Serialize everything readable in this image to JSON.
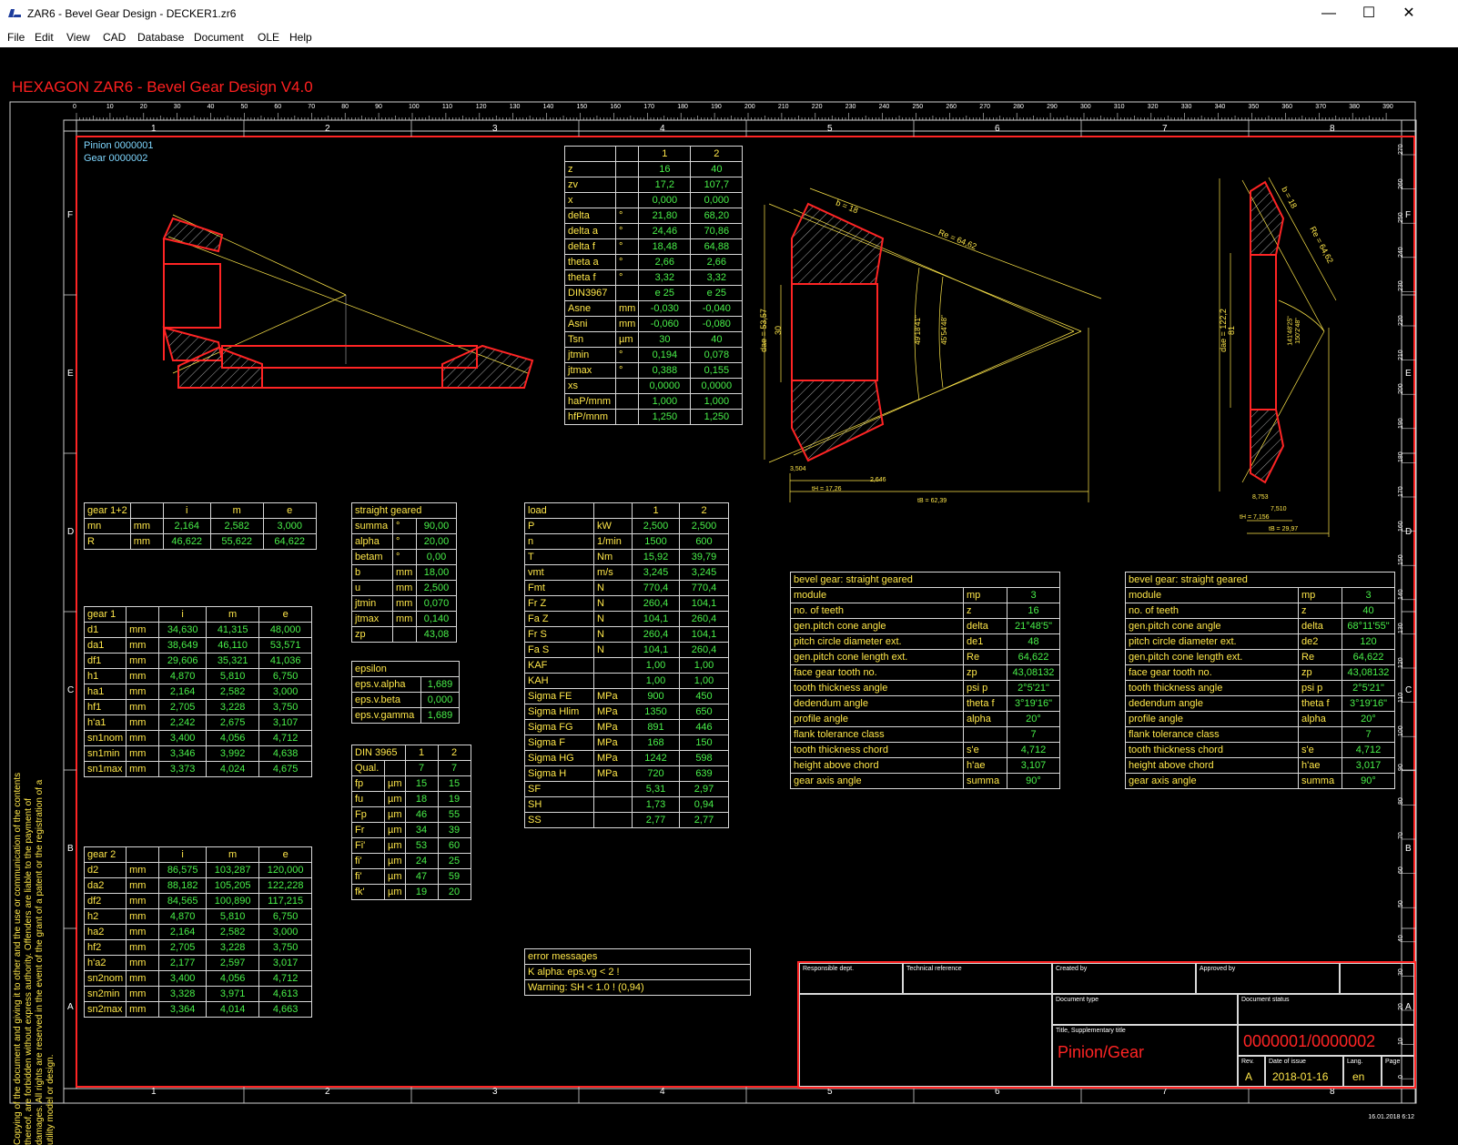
{
  "window": {
    "title": "ZAR6 - Bevel Gear Design  -  DECKER1.zr6",
    "minimize": "—",
    "maximize": "☐",
    "close": "✕"
  },
  "menu": [
    "File",
    "Edit",
    "View",
    "CAD",
    "Database",
    "Document",
    "OLE",
    "Help"
  ],
  "app_title": "HEXAGON   ZAR6 - Bevel Gear Design  V4.0",
  "ruler": {
    "top_ticks": [
      "0",
      "10",
      "20",
      "30",
      "40",
      "50",
      "60",
      "70",
      "80",
      "90",
      "100",
      "110",
      "120",
      "130",
      "140",
      "150",
      "160",
      "170",
      "180",
      "190",
      "200",
      "210",
      "220",
      "230",
      "240",
      "250",
      "260",
      "270",
      "280",
      "290",
      "300",
      "310",
      "320",
      "330",
      "340",
      "350",
      "360",
      "370",
      "380",
      "390"
    ],
    "right_ticks": [
      "270",
      "260",
      "250",
      "240",
      "230",
      "220",
      "210",
      "200",
      "190",
      "180",
      "170",
      "160",
      "150",
      "140",
      "130",
      "120",
      "110",
      "100",
      "90",
      "80",
      "70",
      "60",
      "50",
      "40",
      "30",
      "20",
      "10",
      "0"
    ],
    "columns": [
      "1",
      "2",
      "3",
      "4",
      "5",
      "6",
      "7",
      "8"
    ],
    "rows": [
      "F",
      "E",
      "D",
      "C",
      "B",
      "A"
    ]
  },
  "parts": {
    "pinion": "Pinion  0000001",
    "gear": "Gear  0000002"
  },
  "drawing_labels": {
    "b1": "b = 18",
    "re1": "Re = 64,62",
    "dae1": "dae = 53,57",
    "d1s": "30",
    "ang1a": "49'18'41\"",
    "ang1b": "45'54'48\"",
    "tH1": "tH = 17,26",
    "tB1": "tB = 62,39",
    "v1": "3,504",
    "v2": "2,646",
    "b2": "b = 18",
    "re2": "Re = 64,62",
    "dae2": "dae = 122,2",
    "d2s": "81",
    "ang2a": "141'48'25\"",
    "ang2b": "150'2'48\"",
    "tH2": "tH = 7,156",
    "tB2": "tB = 29,97",
    "v3": "8,753",
    "v4": "7,510"
  },
  "param_table": {
    "header": [
      "",
      "",
      "1",
      "2"
    ],
    "rows": [
      [
        "z",
        "",
        "16",
        "40"
      ],
      [
        "zv",
        "",
        "17,2",
        "107,7"
      ],
      [
        "x",
        "",
        "0,000",
        "0,000"
      ],
      [
        "delta",
        "°",
        "21,80",
        "68,20"
      ],
      [
        "delta a",
        "°",
        "24,46",
        "70,86"
      ],
      [
        "delta f",
        "°",
        "18,48",
        "64,88"
      ],
      [
        "theta a",
        "°",
        "2,66",
        "2,66"
      ],
      [
        "theta f",
        "°",
        "3,32",
        "3,32"
      ],
      [
        "DIN3967",
        "",
        "e 25",
        "e 25"
      ],
      [
        "Asne",
        "mm",
        "-0,030",
        "-0,040"
      ],
      [
        "Asni",
        "mm",
        "-0,060",
        "-0,080"
      ],
      [
        "Tsn",
        "µm",
        "30",
        "40"
      ],
      [
        "jtmin",
        "°",
        "0,194",
        "0,078"
      ],
      [
        "jtmax",
        "°",
        "0,388",
        "0,155"
      ],
      [
        "xs",
        "",
        "0,0000",
        "0,0000"
      ],
      [
        "haP/mnm",
        "",
        "1,000",
        "1,000"
      ],
      [
        "hfP/mnm",
        "",
        "1,250",
        "1,250"
      ]
    ]
  },
  "gear12": {
    "header": [
      "gear 1+2",
      "",
      "i",
      "m",
      "e"
    ],
    "rows": [
      [
        "mn",
        "mm",
        "2,164",
        "2,582",
        "3,000"
      ],
      [
        "R",
        "mm",
        "46,622",
        "55,622",
        "64,622"
      ]
    ]
  },
  "gear1": {
    "header": [
      "gear 1",
      "",
      "i",
      "m",
      "e"
    ],
    "rows": [
      [
        "d1",
        "mm",
        "34,630",
        "41,315",
        "48,000"
      ],
      [
        "da1",
        "mm",
        "38,649",
        "46,110",
        "53,571"
      ],
      [
        "df1",
        "mm",
        "29,606",
        "35,321",
        "41,036"
      ],
      [
        "h1",
        "mm",
        "4,870",
        "5,810",
        "6,750"
      ],
      [
        "ha1",
        "mm",
        "2,164",
        "2,582",
        "3,000"
      ],
      [
        "hf1",
        "mm",
        "2,705",
        "3,228",
        "3,750"
      ],
      [
        "h'a1",
        "mm",
        "2,242",
        "2,675",
        "3,107"
      ],
      [
        "sn1nom",
        "mm",
        "3,400",
        "4,056",
        "4,712"
      ],
      [
        "sn1min",
        "mm",
        "3,346",
        "3,992",
        "4,638"
      ],
      [
        "sn1max",
        "mm",
        "3,373",
        "4,024",
        "4,675"
      ]
    ]
  },
  "gear2": {
    "header": [
      "gear 2",
      "",
      "i",
      "m",
      "e"
    ],
    "rows": [
      [
        "d2",
        "mm",
        "86,575",
        "103,287",
        "120,000"
      ],
      [
        "da2",
        "mm",
        "88,182",
        "105,205",
        "122,228"
      ],
      [
        "df2",
        "mm",
        "84,565",
        "100,890",
        "117,215"
      ],
      [
        "h2",
        "mm",
        "4,870",
        "5,810",
        "6,750"
      ],
      [
        "ha2",
        "mm",
        "2,164",
        "2,582",
        "3,000"
      ],
      [
        "hf2",
        "mm",
        "2,705",
        "3,228",
        "3,750"
      ],
      [
        "h'a2",
        "mm",
        "2,177",
        "2,597",
        "3,017"
      ],
      [
        "sn2nom",
        "mm",
        "3,400",
        "4,056",
        "4,712"
      ],
      [
        "sn2min",
        "mm",
        "3,328",
        "3,971",
        "4,613"
      ],
      [
        "sn2max",
        "mm",
        "3,364",
        "4,014",
        "4,663"
      ]
    ]
  },
  "straight": {
    "header": [
      "straight geared"
    ],
    "rows": [
      [
        "summa",
        "°",
        "90,00"
      ],
      [
        "alpha",
        "°",
        "20,00"
      ],
      [
        "betam",
        "°",
        "0,00"
      ],
      [
        "b",
        "mm",
        "18,00"
      ],
      [
        "u",
        "mm",
        "2,500"
      ],
      [
        "jtmin",
        "mm",
        "0,070"
      ],
      [
        "jtmax",
        "mm",
        "0,140"
      ],
      [
        "zp",
        "",
        "43,08"
      ]
    ]
  },
  "epsilon": {
    "header": [
      "epsilon"
    ],
    "rows": [
      [
        "eps.v.alpha",
        "1,689"
      ],
      [
        "eps.v.beta",
        "0,000"
      ],
      [
        "eps.v.gamma",
        "1,689"
      ]
    ]
  },
  "din3965": {
    "header": [
      "DIN 3965",
      "1",
      "2"
    ],
    "rows": [
      [
        "Qual.",
        "",
        "7",
        "7"
      ],
      [
        "fp",
        "µm",
        "15",
        "15"
      ],
      [
        "fu",
        "µm",
        "18",
        "19"
      ],
      [
        "Fp",
        "µm",
        "46",
        "55"
      ],
      [
        "Fr",
        "µm",
        "34",
        "39"
      ],
      [
        "Fi'",
        "µm",
        "53",
        "60"
      ],
      [
        "fi'",
        "µm",
        "24",
        "25"
      ],
      [
        "fi'",
        "µm",
        "47",
        "59"
      ],
      [
        "fk'",
        "µm",
        "19",
        "20"
      ]
    ]
  },
  "load": {
    "header": [
      "load",
      "",
      "1",
      "2"
    ],
    "rows": [
      [
        "P",
        "kW",
        "2,500",
        "2,500"
      ],
      [
        "n",
        "1/min",
        "1500",
        "600"
      ],
      [
        "T",
        "Nm",
        "15,92",
        "39,79"
      ],
      [
        "vmt",
        "m/s",
        "3,245",
        "3,245"
      ],
      [
        "Fmt",
        "N",
        "770,4",
        "770,4"
      ],
      [
        "Fr Z",
        "N",
        "260,4",
        "104,1"
      ],
      [
        "Fa Z",
        "N",
        "104,1",
        "260,4"
      ],
      [
        "Fr S",
        "N",
        "260,4",
        "104,1"
      ],
      [
        "Fa S",
        "N",
        "104,1",
        "260,4"
      ],
      [
        "KAF",
        "",
        "1,00",
        "1,00"
      ],
      [
        "KAH",
        "",
        "1,00",
        "1,00"
      ],
      [
        "Sigma FE",
        "MPa",
        "900",
        "450"
      ],
      [
        "Sigma Hlim",
        "MPa",
        "1350",
        "650"
      ],
      [
        "Sigma FG",
        "MPa",
        "891",
        "446"
      ],
      [
        "Sigma F",
        "MPa",
        "168",
        "150"
      ],
      [
        "Sigma HG",
        "MPa",
        "1242",
        "598"
      ],
      [
        "Sigma H",
        "MPa",
        "720",
        "639"
      ],
      [
        "SF",
        "",
        "5,31",
        "2,97"
      ],
      [
        "SH",
        "",
        "1,73",
        "0,94"
      ],
      [
        "SS",
        "",
        "2,77",
        "2,77"
      ]
    ]
  },
  "errors": {
    "header": "error messages",
    "rows": [
      "K alpha: eps.vg < 2 !",
      "Warning: SH < 1.0 ! (0,94)"
    ]
  },
  "bevel1": {
    "header": "bevel gear:  straight geared",
    "rows": [
      [
        "module",
        "mp",
        "3"
      ],
      [
        "no. of teeth",
        "z",
        "16"
      ],
      [
        "gen.pitch cone angle",
        "delta",
        "21°48'5\""
      ],
      [
        "pitch circle diameter ext.",
        "de1",
        "48"
      ],
      [
        "gen.pitch cone length ext.",
        "Re",
        "64,622"
      ],
      [
        "face gear tooth no.",
        "zp",
        "43,08132"
      ],
      [
        "tooth thickness angle",
        "psi p",
        "2°5'21\""
      ],
      [
        "dedendum angle",
        "theta f",
        "3°19'16\""
      ],
      [
        "profile angle",
        "alpha",
        "20°"
      ],
      [
        "flank tolerance class",
        "",
        "7"
      ],
      [
        "tooth thickness chord",
        "s'e",
        "4,712"
      ],
      [
        "height above chord",
        "h'ae",
        "3,107"
      ],
      [
        "gear axis angle",
        "summa",
        "90°"
      ]
    ]
  },
  "bevel2": {
    "header": "bevel gear:  straight geared",
    "rows": [
      [
        "module",
        "mp",
        "3"
      ],
      [
        "no. of teeth",
        "z",
        "40"
      ],
      [
        "gen.pitch cone angle",
        "delta",
        "68°11'55\""
      ],
      [
        "pitch circle diameter ext.",
        "de2",
        "120"
      ],
      [
        "gen.pitch cone length ext.",
        "Re",
        "64,622"
      ],
      [
        "face gear tooth no.",
        "zp",
        "43,08132"
      ],
      [
        "tooth thickness angle",
        "psi p",
        "2°5'21\""
      ],
      [
        "dedendum angle",
        "theta f",
        "3°19'16\""
      ],
      [
        "profile angle",
        "alpha",
        "20°"
      ],
      [
        "flank tolerance class",
        "",
        "7"
      ],
      [
        "tooth thickness chord",
        "s'e",
        "4,712"
      ],
      [
        "height above chord",
        "h'ae",
        "3,017"
      ],
      [
        "gear axis angle",
        "summa",
        "90°"
      ]
    ]
  },
  "title_block": {
    "resp_dept": "Responsible dept.",
    "tech_ref": "Technical reference",
    "created_by": "Created by",
    "approved_by": "Approved by",
    "doc_type": "Document type",
    "doc_status": "Document status",
    "title_label": "Title, Supplementary title",
    "title": "Pinion/Gear",
    "doc_number": "0000001/0000002",
    "rev_label": "Rev.",
    "rev": "A",
    "date_label": "Date of issue",
    "date": "2018-01-16",
    "lang_label": "Lang.",
    "lang": "en",
    "page_label": "Page"
  },
  "copyright": "Copying of the document and giving it to other and the use or communication of the contents thereof, are forbidden without express authority. Offenders are liable to the payment of damages. All rights are reserved in the event of the grant of a patent or the registration of a utility model or design.",
  "timestamp": "16.01.2018 6:12"
}
